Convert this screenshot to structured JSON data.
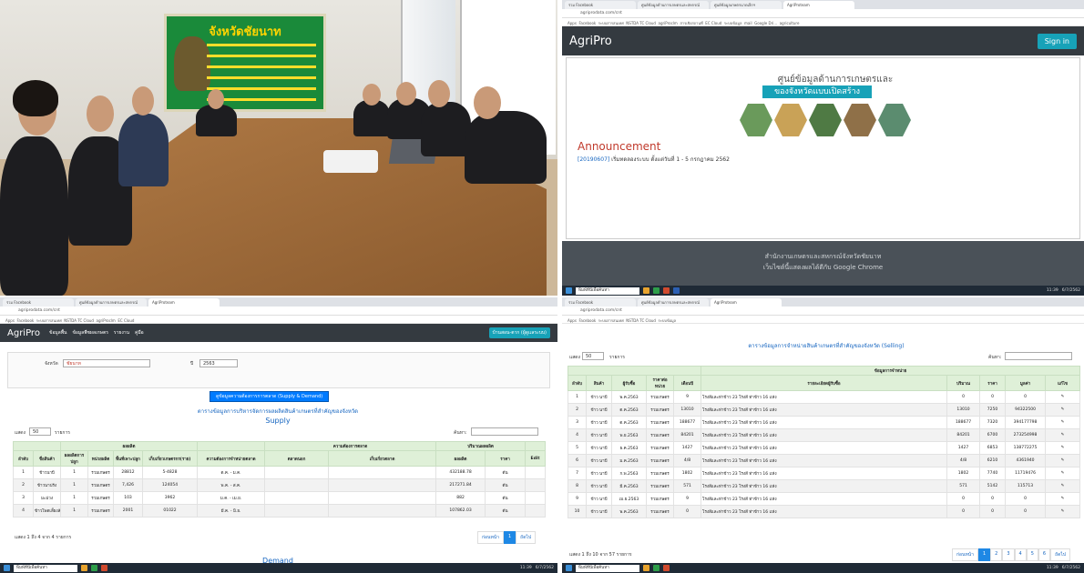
{
  "photo": {
    "banner_text": "จังหวัดชัยนาท"
  },
  "browser_top": {
    "tabs": [
      "ร่วม Facebook",
      "ศูนย์ข้อมูลด้านการเกษตรและสหกรณ์",
      "ศูนย์ข้อมูลเกษตรนาดเล็กฯ",
      "AgriProteam"
    ],
    "url": "agriprodata.com/cnt",
    "bookmarks": [
      "Apps",
      "Facebook",
      "ระบบสารสนเทศ",
      "NSTDA TC Cloud",
      "agriProclm",
      "สารเชิงสถานที่",
      "EC Cloud",
      "ระบบข้อมูล",
      "mail",
      "Google Dri...",
      "agriculture"
    ]
  },
  "agripro": {
    "brand": "AgriPro",
    "sign_in": "Sign in",
    "hero_title": "ศูนย์ข้อมูลด้านการเกษตรและสหกรณ์",
    "hero_sub": "ของจังหวัดแบบเปิดสร้าง",
    "announcement_heading": "Announcement",
    "announcement_date": "[20190607]",
    "announcement_text": "เริ่มทดลองระบบ ตั้งแต่วันที่ 1 - 5 กรกฎาคม 2562",
    "footer1": "สำนักงานเกษตรและสหกรณ์จังหวัดชัยนาท",
    "footer2": "เว็บไซต์นี้แสดงผลได้ดีกับ Google Chrome"
  },
  "taskbar": {
    "search": "พิมพ์ที่นี่เพื่อค้นหา",
    "time": "11:39",
    "date": "6/7/2562"
  },
  "supply": {
    "nav": [
      "ข้อมูลพื้น",
      "ข้อมูลพืชผลเกษตร",
      "รายงาน",
      "คู่มือ"
    ],
    "user_btn": "บ้านสอน-ตาก (ผู้ดูแลระบบ)",
    "province_label": "จังหวัด",
    "province": "ชัยนาท",
    "year_label": "ปี",
    "year": "2563",
    "main_btn": "ดูข้อมูลความต้องการการตลาด (Supply & Demand)",
    "title": "ตารางข้อมูลการบริหารจัดการผลผลิตสินค้าเกษตรที่สำคัญของจังหวัด",
    "subtitle": "Supply",
    "show_label": "แสดง",
    "show_value": "50",
    "rows_label": "รายการ",
    "search_label": "ค้นหา:",
    "groups": [
      "ผลผลิต",
      "ความต้องการตลาด",
      "ปริมาณผลผลิต"
    ],
    "headers": [
      "ลำดับ",
      "ชื่อสินค้า",
      "ผลผลิตการปลูก",
      "หน่วยผลิต",
      "พื้นที่เพาะปลูก",
      "เก็บเกี่ยวเกษตรกร(ราย)",
      "ความต้องการจำหน่ายตลาด",
      "ตลาดนอก",
      "เก็บเกี่ยวตลาด",
      "ผลผลิต",
      "ราคา",
      "Edit"
    ],
    "rows": [
      [
        "1",
        "ข้าวนาปี",
        "1",
        "รวมเกษตร",
        "28812",
        "5-4828",
        "ต.ค. - ม.ค.",
        "",
        "",
        "432188.78",
        "ตัน",
        ""
      ],
      [
        "2",
        "ข้าวนาปรัง",
        "1",
        "รวมเกษตร",
        "7,426",
        "124054",
        "พ.ค. - ส.ค.",
        "",
        "",
        "217271.84",
        "ตัน",
        ""
      ],
      [
        "3",
        "มะม่วง",
        "1",
        "รวมเกษตร",
        "103",
        "3962",
        "ม.ค. - เม.ย.",
        "",
        "",
        "882",
        "ตัน",
        ""
      ],
      [
        "4",
        "ข้าวโพดเลี้ยงสัตว์",
        "1",
        "รวมเกษตร",
        "2001",
        "01022",
        "มี.ค. - มิ.ย.",
        "",
        "",
        "107862.03",
        "ตัน",
        ""
      ]
    ],
    "footer_info": "แสดง 1 ถึง 4 จาก 4 รายการ",
    "prev": "ก่อนหน้า",
    "page": "1",
    "next": "ถัดไป",
    "demand": "Demand"
  },
  "selling": {
    "title": "ตารางข้อมูลการจำหน่ายสินค้าเกษตรที่สำคัญของจังหวัด (Selling)",
    "show_label": "แสดง",
    "show_value": "50",
    "rows_label": "รายการ",
    "search_label": "ค้นหา:",
    "group": "ข้อมูลการจำหน่าย",
    "headers": [
      "ลำดับ",
      "สินค้า",
      "ผู้รับซื้อ",
      "ราคาต่อหน่วย",
      "เดือนปี",
      "รายละเอียดผู้รับซื้อ",
      "ปริมาณ",
      "ราคา",
      "มูลค่า",
      "แก้ไข"
    ],
    "rows": [
      [
        "1",
        "ข้าว นาปี",
        "พ.ค.2563",
        "รวมเกษตร",
        "9",
        "โรงสีและท่าข้าว 23 โรงสี ท่าข้าว 16 แห่ง",
        "0",
        "0",
        "0"
      ],
      [
        "2",
        "ข้าว นาปี",
        "ต.ค.2563",
        "รวมเกษตร",
        "13010",
        "โรงสีและท่าข้าว 23 โรงสี ท่าข้าว 16 แห่ง",
        "13010",
        "7250",
        "94322500"
      ],
      [
        "3",
        "ข้าว นาปี",
        "ต.ค.2563",
        "รวมเกษตร",
        "188677",
        "โรงสีและท่าข้าว 23 โรงสี ท่าข้าว 16 แห่ง",
        "188677",
        "7320",
        "394177798"
      ],
      [
        "4",
        "ข้าว นาปี",
        "พ.ย.2563",
        "รวมเกษตร",
        "84201",
        "โรงสีและท่าข้าว 23 โรงสี ท่าข้าว 16 แห่ง",
        "84201",
        "6700",
        "273254998"
      ],
      [
        "5",
        "ข้าว นาปี",
        "ธ.ค.2563",
        "รวมเกษตร",
        "1427",
        "โรงสีและท่าข้าว 23 โรงสี ท่าข้าว 16 แห่ง",
        "1427",
        "6853",
        "138772275"
      ],
      [
        "6",
        "ข้าว นาปี",
        "ม.ค.2563",
        "รวมเกษตร",
        "4/8",
        "โรงสีและท่าข้าว 23 โรงสี ท่าข้าว 16 แห่ง",
        "4/8",
        "6210",
        "4361940"
      ],
      [
        "7",
        "ข้าว นาปี",
        "ก.พ.2563",
        "รวมเกษตร",
        "1802",
        "โรงสีและท่าข้าว 23 โรงสี ท่าข้าว 16 แห่ง",
        "1802",
        "7740",
        "11719476"
      ],
      [
        "8",
        "ข้าว นาปี",
        "มี.ค.2563",
        "รวมเกษตร",
        "571",
        "โรงสีและท่าข้าว 23 โรงสี ท่าข้าว 16 แห่ง",
        "571",
        "5142",
        "115713"
      ],
      [
        "9",
        "ข้าว นาปี",
        "เม.ย.2563",
        "รวมเกษตร",
        "9",
        "โรงสีและท่าข้าว 23 โรงสี ท่าข้าว 16 แห่ง",
        "0",
        "0",
        "0"
      ],
      [
        "10",
        "ข้าว นาปี",
        "พ.ค.2563",
        "รวมเกษตร",
        "0",
        "โรงสีและท่าข้าว 23 โรงสี ท่าข้าว 16 แห่ง",
        "0",
        "0",
        "0"
      ]
    ],
    "footer_info": "แสดง 1 ถึง 10 จาก 57 รายการ",
    "prev": "ก่อนหน้า",
    "pages": [
      "1",
      "2",
      "3",
      "4",
      "5",
      "6"
    ],
    "next": "ถัดไป"
  },
  "colors": {
    "navbar": "#343a40",
    "accent": "#17a2b8",
    "header_green": "#dff0d8",
    "announce": "#c0392b"
  }
}
